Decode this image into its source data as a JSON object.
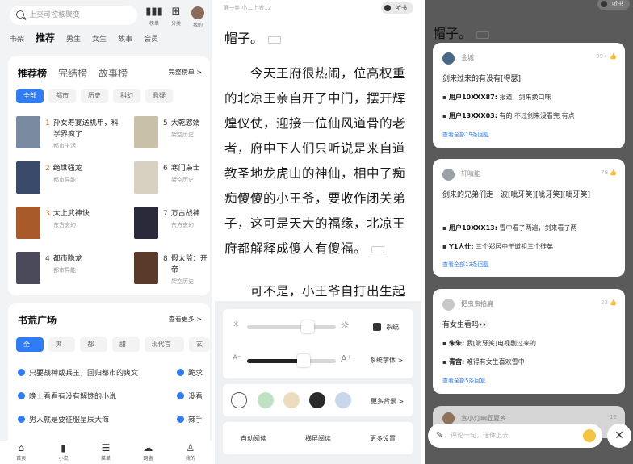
{
  "left": {
    "search_placeholder": "上交可控核聚变",
    "top_icons": [
      {
        "label": "榜单",
        "icon": "chart-icon"
      },
      {
        "label": "分类",
        "icon": "grid-icon"
      },
      {
        "label": "我的",
        "icon": "avatar"
      }
    ],
    "nav": [
      "书架",
      "推荐",
      "男生",
      "女生",
      "故事",
      "会员"
    ],
    "rank_tabs": [
      "推荐榜",
      "完结榜",
      "故事榜"
    ],
    "rank_more": "完整榜单 >",
    "rank_chips": [
      "全部",
      "都市",
      "历史",
      "科幻",
      "悬疑"
    ],
    "books": [
      {
        "rank": "1",
        "title": "孙女寿宴送机甲，科",
        "title2": "学界疯了",
        "cat": "都市生活",
        "color": "#7a8aa0"
      },
      {
        "rank": "2",
        "title": "绝世强龙",
        "cat": "都市异能",
        "color": "#3a4a6a"
      },
      {
        "rank": "3",
        "title": "太上武神诀",
        "cat": "东方玄幻",
        "color": "#a85a2a"
      },
      {
        "rank": "4",
        "title": "都市隐龙",
        "cat": "都市异能",
        "color": "#4a4a5a"
      },
      {
        "rank": "5",
        "title": "大乾憨婿",
        "cat": "架空历史",
        "color": "#c8c0a8"
      },
      {
        "rank": "6",
        "title": "寒门枭士",
        "cat": "架空历史",
        "color": "#d8d0c0"
      },
      {
        "rank": "7",
        "title": "万古战神",
        "cat": "东方玄幻",
        "color": "#2a2a3a"
      },
      {
        "rank": "8",
        "title": "假太监：开",
        "title2": "帝",
        "cat": "架空历史",
        "color": "#5a3a2a"
      }
    ],
    "plaza_title": "书荒广场",
    "plaza_more": "查看更多 >",
    "plaza_chips": [
      "全部",
      "爽文",
      "都市",
      "甜宠",
      "现代言情",
      "玄"
    ],
    "plaza_items": [
      {
        "left": "只要战神或兵王，回归都市的爽文",
        "right": "跪求"
      },
      {
        "left": "晚上看看有没有解馋的小说",
        "right": "没看"
      },
      {
        "left": "男人就是要征服星辰大海",
        "right": "辣手"
      }
    ],
    "tabbar": [
      {
        "label": "首页",
        "icon": "home-icon"
      },
      {
        "label": "小说",
        "icon": "book-icon"
      },
      {
        "label": "菜单",
        "icon": "menu-icon"
      },
      {
        "label": "网盘",
        "icon": "cloud-icon"
      },
      {
        "label": "我的",
        "icon": "user-icon"
      }
    ]
  },
  "middle": {
    "header": "第一卷 小二上者",
    "header_num": "12",
    "listen": "听书",
    "chapter_title": "帽子。",
    "paragraphs": [
      "今天王府很热闹，位高权重的北凉王亲自开了中门，摆开辉煌仪仗，迎接一位仙风道骨的老者，府中下人们只听说是来自道教圣地龙虎山的神仙，相中了痴痴傻傻的小王爷，要收作闭关弟子，这可是天大的福缘，北凉王府都解释成傻人有傻福。",
      "可不是，小王爷自打出生起"
    ],
    "brightness_system": "系统",
    "font_label": "系统字体 >",
    "more_bg": "更多背景 >",
    "bg_colors": [
      "#ffffff",
      "#bfe3c2",
      "#eadcbc",
      "#2a2a2a",
      "#c8d8ea"
    ],
    "bottom_buttons": [
      "自动阅读",
      "横屏阅读",
      "更多设置"
    ]
  },
  "right": {
    "listen": "听书",
    "chapter_title": "帽子。",
    "comments": [
      {
        "user": "金城",
        "likes": "99+",
        "text": "剑来过来的有没有[得瑟]",
        "replies": [
          {
            "user": "用户10XXX87:",
            "text": " 报道，剑来换口味"
          },
          {
            "user": "用户13XXX03:",
            "text": " 有的 不过剑来没看完 有点"
          }
        ],
        "more": "查看全部19条回复",
        "avatar": "#4a6a8a"
      },
      {
        "user": "轩晴能",
        "likes": "78",
        "text": "剑来的兄弟们走一波[呲牙笑][呲牙笑][呲牙笑]",
        "replies": [
          {
            "user": "用户10XXX13:",
            "text": " 雪中看了两遍，剑来看了两"
          },
          {
            "user": "Y1人仕:",
            "text": " 三个郑居中干道祖三个徒弟"
          }
        ],
        "more": "查看全部13条回复",
        "avatar": "#9aa0a8"
      },
      {
        "user": "把虫虫拍扁",
        "likes": "23",
        "text": "有女生看吗👀",
        "replies": [
          {
            "user": "朱朱:",
            "text": " 我[呲牙笑]电视剧过来的"
          },
          {
            "user": "青宫:",
            "text": " 难得有女生喜欢雪中"
          }
        ],
        "more": "查看全部5条回复",
        "avatar": "#c8c8c8"
      }
    ],
    "peek_user": "宣小灯幽匠夏乡",
    "peek_likes": "12",
    "input_placeholder": "评论一句，送你上去",
    "close": "✕"
  }
}
